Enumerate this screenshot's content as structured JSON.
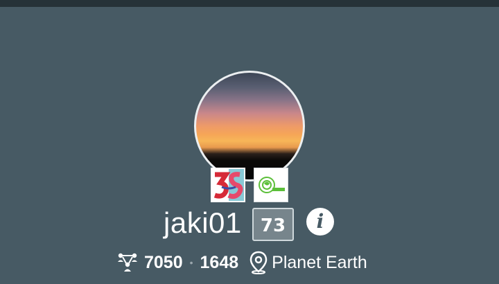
{
  "profile": {
    "username": "jaki01",
    "level": "73",
    "info_icon": "info-icon"
  },
  "badges": [
    {
      "name": "3s-badge",
      "label": "3S"
    },
    {
      "name": "green-badge",
      "label": ""
    }
  ],
  "stats": {
    "followers": "7050",
    "separator": "•",
    "following": "1648",
    "location": "Planet Earth"
  },
  "icons": {
    "network": "network-icon",
    "location": "location-pin-icon"
  },
  "colors": {
    "background": "#475a64",
    "topbar": "#263238",
    "level_bg": "#77858c"
  }
}
